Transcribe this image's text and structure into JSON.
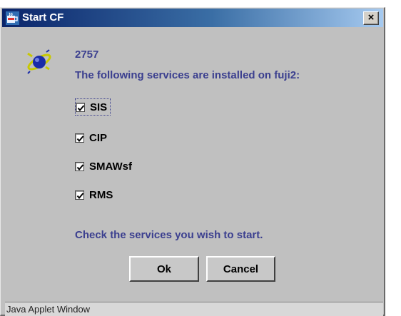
{
  "caption_fragment": "",
  "window": {
    "title": "Start CF",
    "close_glyph": "×"
  },
  "message": {
    "code": "2757",
    "text": "The following services are installed on fuji2:"
  },
  "services": [
    {
      "label": "SIS",
      "checked": true
    },
    {
      "label": "CIP",
      "checked": true
    },
    {
      "label": "SMAWsf",
      "checked": true
    },
    {
      "label": "RMS",
      "checked": true
    }
  ],
  "hint": "Check the services you wish to start.",
  "buttons": {
    "ok": "Ok",
    "cancel": "Cancel"
  },
  "statusbar": "Java Applet Window",
  "icons": {
    "app": "java-coffee-icon",
    "info": "satellite-icon",
    "check": "checkmark-icon"
  }
}
